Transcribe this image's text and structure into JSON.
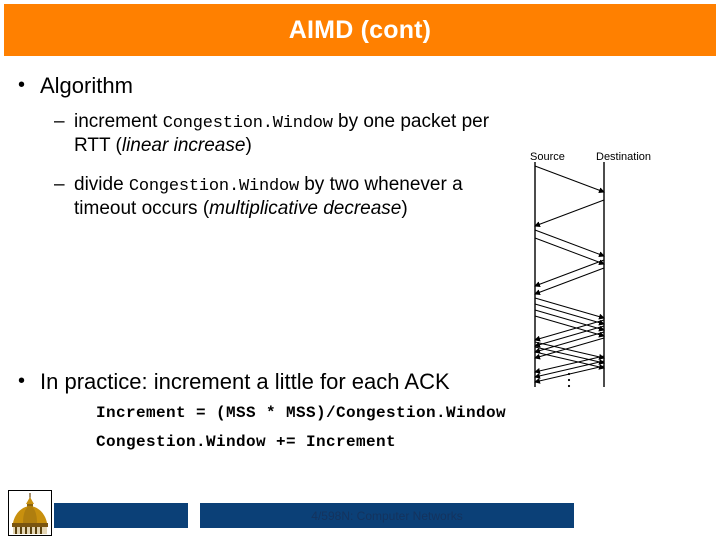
{
  "slide": {
    "title": "AIMD (cont)",
    "title_bg": "#FF8000",
    "title_color": "#FFFFFF"
  },
  "bullets": [
    {
      "level": 1,
      "marker": "•",
      "text": "Algorithm"
    },
    {
      "level": 2,
      "marker": "–",
      "segments": [
        {
          "style": "normal",
          "text": "increment "
        },
        {
          "style": "mono",
          "text": "Congestion.Window"
        },
        {
          "style": "normal",
          "text": " by one packet per RTT ("
        },
        {
          "style": "italic",
          "text": "linear increase"
        },
        {
          "style": "normal",
          "text": ")"
        }
      ]
    },
    {
      "level": 2,
      "marker": "–",
      "segments": [
        {
          "style": "normal",
          "text": "divide "
        },
        {
          "style": "mono",
          "text": "Congestion.Window"
        },
        {
          "style": "normal",
          "text": " by two whenever a timeout occurs ("
        },
        {
          "style": "italic",
          "text": "multiplicative decrease"
        },
        {
          "style": "normal",
          "text": ")"
        }
      ]
    },
    {
      "level": 1,
      "marker": "•",
      "text": "In practice: increment a little for each ACK"
    }
  ],
  "bullet_texts": {
    "algorithm": "Algorithm",
    "in_practice": "In practice: increment a little for each ACK",
    "b2_pre": "increment ",
    "b2_mono": "Congestion.Window",
    "b2_mid": " by one packet per RTT (",
    "b2_ital": "linear increase",
    "b2_post": ")",
    "b3_pre": "divide ",
    "b3_mono": "Congestion.Window",
    "b3_mid": " by two whenever a timeout occurs (",
    "b3_ital": "multiplicative decrease",
    "b3_post": ")",
    "dot": "•",
    "dash": "–"
  },
  "code": {
    "line1": "Increment = (MSS * MSS)/Congestion.Window",
    "line2": "Congestion.Window += Increment"
  },
  "diagram": {
    "source_label": "Source",
    "destination_label": "Destination",
    "ellipsis": "⋮",
    "line_color": "#000000",
    "description": "TCP additive increase timing diagram: packets sent from source to destination with returning ACKs, window growing each RTT"
  },
  "footer": {
    "course_text": "4/598N: Computer Networks",
    "bar_color": "#0B4077",
    "text_color": "#14335E",
    "logo_name": "university-dome-logo"
  }
}
